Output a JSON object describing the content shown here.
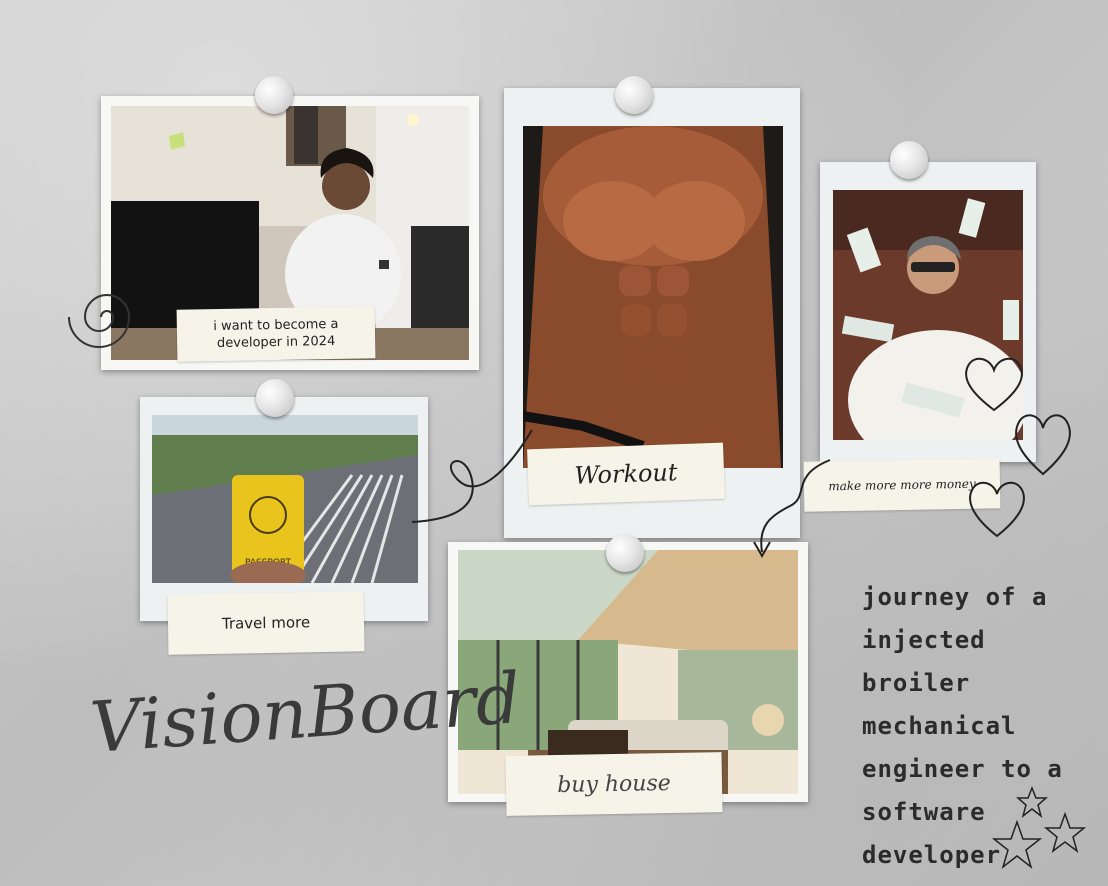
{
  "board": {
    "photo1_caption": "i want to become a developer in 2024",
    "photo2_caption": "Workout",
    "photo3_caption": "make more more money",
    "photo4_caption": "Travel more",
    "photo5_caption": "buy house",
    "passport_label": "PASSPORT",
    "title": "VisionBoard",
    "note_lines": [
      "journey of a",
      "injected broiler",
      "mechanical",
      "engineer to a",
      "software",
      "developer"
    ]
  },
  "icons": [
    "push-pin-icon",
    "heart-icon",
    "star-icon",
    "swirl-icon",
    "curved-arrow-icon"
  ]
}
